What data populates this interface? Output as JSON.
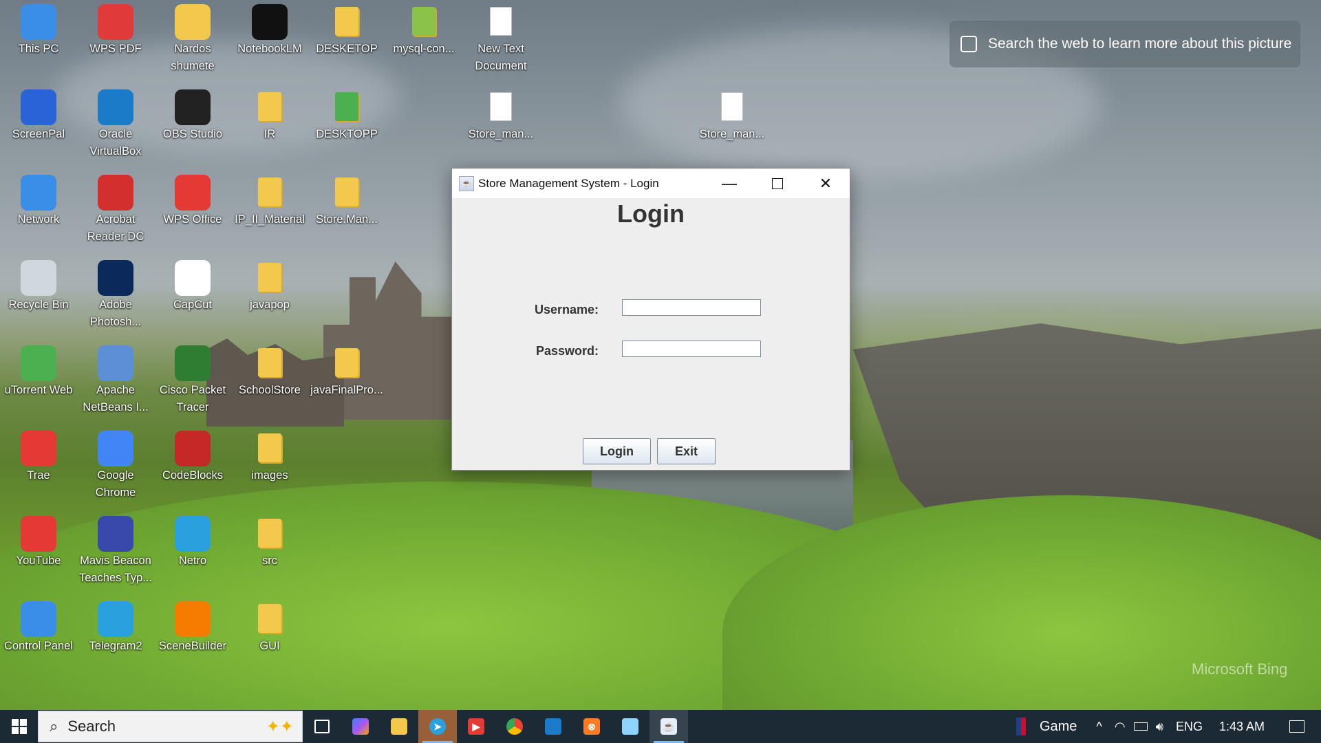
{
  "desktop": {
    "icons": [
      {
        "label": "This PC",
        "icon": "this-pc-icon",
        "color": "#3a8ee6"
      },
      {
        "label": "WPS PDF",
        "icon": "wps-pdf-icon",
        "color": "#e03a3a"
      },
      {
        "label": "Nardos shumete",
        "icon": "user-folder-icon",
        "color": "#f2c94c"
      },
      {
        "label": "NotebookLM",
        "icon": "notebooklm-icon",
        "color": "#111111"
      },
      {
        "label": "DESKETOP",
        "icon": "folder-icon",
        "color": "#f2c94c"
      },
      {
        "label": "mysql-con...",
        "icon": "folder-icon",
        "color": "#8bc34a"
      },
      {
        "label": "New Text Document",
        "icon": "text-document-icon",
        "color": "#ffffff"
      },
      {
        "label": "ScreenPal",
        "icon": "screenpal-icon",
        "color": "#2a63d6"
      },
      {
        "label": "Oracle VirtualBox",
        "icon": "virtualbox-icon",
        "color": "#1c7bc8"
      },
      {
        "label": "OBS Studio",
        "icon": "obs-studio-icon",
        "color": "#222222"
      },
      {
        "label": "IR",
        "icon": "folder-icon",
        "color": "#f2c94c"
      },
      {
        "label": "DESKTOPP",
        "icon": "folder-icon",
        "color": "#4caf50"
      },
      {
        "label": "Store_man...",
        "icon": "text-document-icon",
        "color": "#ffffff"
      },
      {
        "label": "Store_man...",
        "icon": "text-document-icon",
        "color": "#ffffff"
      },
      {
        "label": "Network",
        "icon": "network-icon",
        "color": "#3a8ee6"
      },
      {
        "label": "Acrobat Reader DC",
        "icon": "acrobat-icon",
        "color": "#d32f2f"
      },
      {
        "label": "WPS Office",
        "icon": "wps-office-icon",
        "color": "#e53935"
      },
      {
        "label": "IP_II_Material",
        "icon": "folder-icon",
        "color": "#f2c94c"
      },
      {
        "label": "Store.Man...",
        "icon": "folder-icon",
        "color": "#f2c94c"
      },
      {
        "label": "Recycle Bin",
        "icon": "recycle-bin-icon",
        "color": "#cfd8dc"
      },
      {
        "label": "Adobe Photosh...",
        "icon": "photoshop-icon",
        "color": "#0b2a5b"
      },
      {
        "label": "CapCut",
        "icon": "capcut-icon",
        "color": "#ffffff"
      },
      {
        "label": "javapop",
        "icon": "folder-icon",
        "color": "#f2c94c"
      },
      {
        "label": "uTorrent Web",
        "icon": "utorrent-icon",
        "color": "#4caf50"
      },
      {
        "label": "Apache NetBeans I...",
        "icon": "netbeans-icon",
        "color": "#5b8fd6"
      },
      {
        "label": "Cisco Packet Tracer",
        "icon": "packet-tracer-icon",
        "color": "#2e7d32"
      },
      {
        "label": "SchoolStore",
        "icon": "folder-icon",
        "color": "#f2c94c"
      },
      {
        "label": "javaFinalPro...",
        "icon": "folder-icon",
        "color": "#f2c94c"
      },
      {
        "label": "Trae",
        "icon": "trae-icon",
        "color": "#e53935"
      },
      {
        "label": "Google Chrome",
        "icon": "chrome-icon",
        "color": "#4285f4"
      },
      {
        "label": "CodeBlocks",
        "icon": "codeblocks-icon",
        "color": "#c62828"
      },
      {
        "label": "images",
        "icon": "folder-icon",
        "color": "#f2c94c"
      },
      {
        "label": "YouTube",
        "icon": "youtube-icon",
        "color": "#e53935"
      },
      {
        "label": "Mavis Beacon Teaches Typ...",
        "icon": "mavis-beacon-icon",
        "color": "#3949ab"
      },
      {
        "label": "Netro",
        "icon": "telegram-icon",
        "color": "#2aa1de"
      },
      {
        "label": "src",
        "icon": "folder-icon",
        "color": "#f2c94c"
      },
      {
        "label": "Control Panel",
        "icon": "control-panel-icon",
        "color": "#3a8ee6"
      },
      {
        "label": "Telegram2",
        "icon": "telegram-icon",
        "color": "#2aa1de"
      },
      {
        "label": "SceneBuilder",
        "icon": "scenebuilder-icon",
        "color": "#f57c00"
      },
      {
        "label": "GUI",
        "icon": "folder-icon",
        "color": "#f2c94c"
      }
    ],
    "search_hint": "Search the web to learn more about this picture",
    "watermark": "Microsoft Bing"
  },
  "window": {
    "title": "Store Management System - Login",
    "heading": "Login",
    "username_label": "Username:",
    "password_label": "Password:",
    "username_value": "",
    "password_value": "",
    "login_button": "Login",
    "exit_button": "Exit"
  },
  "taskbar": {
    "search_placeholder": "Search",
    "apps": [
      "task-view-icon",
      "copilot-icon",
      "file-explorer-icon",
      "telegram-icon",
      "youtube-icon",
      "chrome-icon",
      "virtualbox-icon",
      "xampp-icon",
      "notepad-icon",
      "java-app-icon"
    ],
    "game_label": "Game",
    "language": "ENG",
    "time": "1:43 AM"
  }
}
